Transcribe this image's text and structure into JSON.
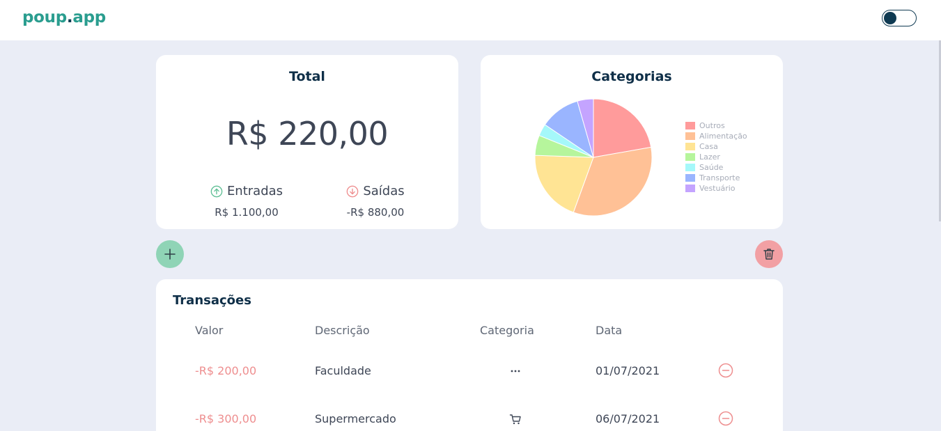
{
  "app": {
    "logo_main": "poup",
    "logo_dot": ".",
    "logo_tail": "app"
  },
  "total_card": {
    "title": "Total",
    "total": "R$ 220,00",
    "incoming_label": "Entradas",
    "incoming_value": "R$ 1.100,00",
    "outgoing_label": "Saídas",
    "outgoing_value": "-R$ 880,00"
  },
  "categories_card": {
    "title": "Categorias",
    "chart_data": {
      "type": "pie",
      "title": "Categorias",
      "legend_position": "right",
      "categories": [
        "Outros",
        "Alimentação",
        "Casa",
        "Lazer",
        "Saúde",
        "Transporte",
        "Vestuário"
      ],
      "values": [
        200,
        300,
        180,
        50,
        30,
        100,
        40
      ],
      "colors": [
        "#ff9b9b",
        "#ffc196",
        "#ffe494",
        "#b6f59c",
        "#a5f8fa",
        "#9ab5ff",
        "#c4a4ff"
      ]
    }
  },
  "actions": {
    "add_icon": "plus-icon",
    "delete_icon": "trash-icon"
  },
  "transactions": {
    "title": "Transações",
    "columns": [
      "Valor",
      "Descrição",
      "Categoria",
      "Data"
    ],
    "rows": [
      {
        "value": "-R$ 200,00",
        "description": "Faculdade",
        "category_icon": "more-dots-icon",
        "date": "01/07/2021"
      },
      {
        "value": "-R$ 300,00",
        "description": "Supermercado",
        "category_icon": "cart-icon",
        "date": "06/07/2021"
      }
    ]
  },
  "colors": {
    "accent": "#2a9d8f",
    "navy": "#0f3a52",
    "income": "#8fd4b6",
    "expense": "#f2a0a4",
    "background": "#eaedf6"
  }
}
